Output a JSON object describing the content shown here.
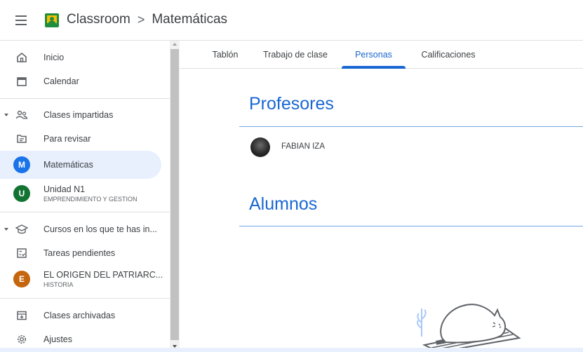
{
  "header": {
    "app_name": "Classroom",
    "separator": ">",
    "course_name": "Matemáticas"
  },
  "sidebar": {
    "items": [
      {
        "label": "Inicio",
        "icon": "home-icon"
      },
      {
        "label": "Calendar",
        "icon": "calendar-icon"
      },
      {
        "label": "Clases impartidas",
        "icon": "people-icon"
      },
      {
        "label": "Para revisar",
        "icon": "folder-icon"
      },
      {
        "label": "Matemáticas",
        "letter": "M",
        "color": "#1a73e8"
      },
      {
        "label": "Unidad N1",
        "subtitle": "EMPRENDIMIENTO Y GESTION",
        "letter": "U",
        "color": "#137333"
      },
      {
        "label": "Cursos en los que te has in...",
        "icon": "graduation-cap-icon"
      },
      {
        "label": "Tareas pendientes",
        "icon": "checklist-icon"
      },
      {
        "label": "EL ORIGEN DEL PATRIARC...",
        "subtitle": "HISTORIA",
        "letter": "E",
        "color": "#c5650d"
      },
      {
        "label": "Clases archivadas",
        "icon": "archive-icon"
      },
      {
        "label": "Ajustes",
        "icon": "gear-icon"
      }
    ]
  },
  "tabs": [
    {
      "label": "Tablón"
    },
    {
      "label": "Trabajo de clase"
    },
    {
      "label": "Personas",
      "active": true
    },
    {
      "label": "Calificaciones"
    }
  ],
  "main": {
    "teachers_title": "Profesores",
    "teacher_name": "FABIAN IZA",
    "students_title": "Alumnos"
  },
  "colors": {
    "accent": "#1967d2",
    "active_bg": "#e8f0fe"
  }
}
